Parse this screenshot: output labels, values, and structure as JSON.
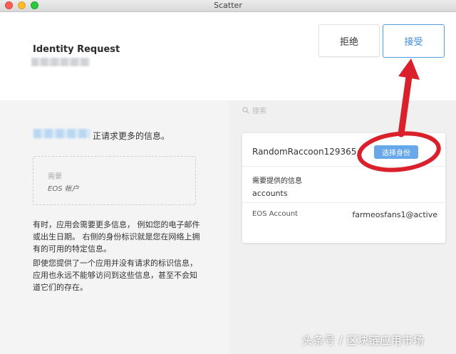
{
  "window": {
    "title": "Scatter"
  },
  "header": {
    "title": "Identity Request",
    "deny_label": "拒绝",
    "accept_label": "接受"
  },
  "left": {
    "requesting_text": "正请求更多的信息。",
    "required_label": "需要",
    "required_item": "EOS 帐户",
    "description_1": "有时，应用会需要更多信息， 例如您的电子邮件或出生日期。 右侧的身份标识就是您在网络上拥有的可用的特定信息。",
    "description_2": "即使您提供了一个应用并没有请求的标识信息， 应用也永远不能够访问到这些信息，甚至不会知道它们的存在。"
  },
  "search": {
    "placeholder": "搜索",
    "icon": "search-icon"
  },
  "identity_card": {
    "name": "RandomRaccoon129365",
    "select_label": "选择身份",
    "needed_label": "需要提供的信息",
    "needed_value": "accounts",
    "eos_label": "EOS Account",
    "eos_value": "farmeosfans1@active"
  },
  "watermark": "头条号 / 区块链应用市场",
  "colors": {
    "accent_blue": "#4f9fe2",
    "select_button": "#68a8ea",
    "annotation_red": "#d9202b",
    "left_pane": "#f4f4f4",
    "right_pane": "#f0f0f0"
  }
}
